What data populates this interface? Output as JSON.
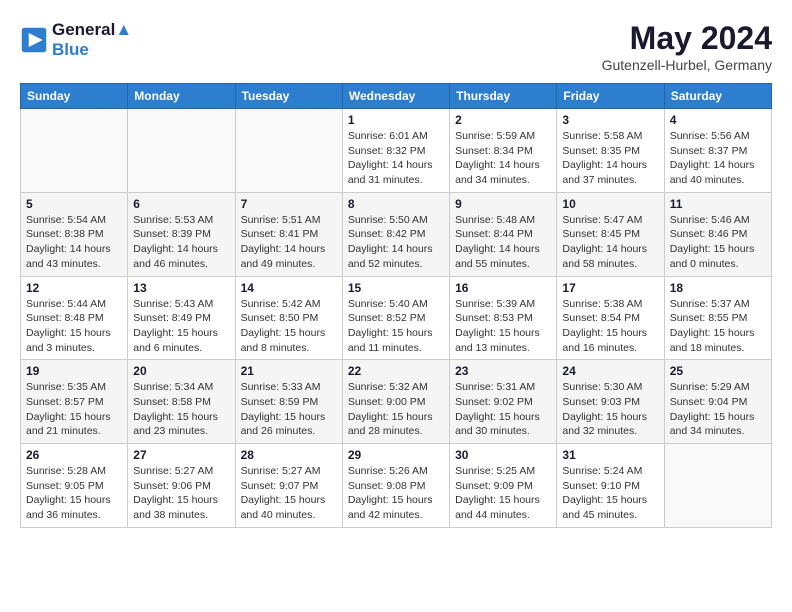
{
  "logo": {
    "line1": "General",
    "line2": "Blue",
    "icon": "▶"
  },
  "title": {
    "month_year": "May 2024",
    "location": "Gutenzell-Hurbel, Germany"
  },
  "weekdays": [
    "Sunday",
    "Monday",
    "Tuesday",
    "Wednesday",
    "Thursday",
    "Friday",
    "Saturday"
  ],
  "weeks": [
    [
      {
        "day": "",
        "info": ""
      },
      {
        "day": "",
        "info": ""
      },
      {
        "day": "",
        "info": ""
      },
      {
        "day": "1",
        "info": "Sunrise: 6:01 AM\nSunset: 8:32 PM\nDaylight: 14 hours\nand 31 minutes."
      },
      {
        "day": "2",
        "info": "Sunrise: 5:59 AM\nSunset: 8:34 PM\nDaylight: 14 hours\nand 34 minutes."
      },
      {
        "day": "3",
        "info": "Sunrise: 5:58 AM\nSunset: 8:35 PM\nDaylight: 14 hours\nand 37 minutes."
      },
      {
        "day": "4",
        "info": "Sunrise: 5:56 AM\nSunset: 8:37 PM\nDaylight: 14 hours\nand 40 minutes."
      }
    ],
    [
      {
        "day": "5",
        "info": "Sunrise: 5:54 AM\nSunset: 8:38 PM\nDaylight: 14 hours\nand 43 minutes."
      },
      {
        "day": "6",
        "info": "Sunrise: 5:53 AM\nSunset: 8:39 PM\nDaylight: 14 hours\nand 46 minutes."
      },
      {
        "day": "7",
        "info": "Sunrise: 5:51 AM\nSunset: 8:41 PM\nDaylight: 14 hours\nand 49 minutes."
      },
      {
        "day": "8",
        "info": "Sunrise: 5:50 AM\nSunset: 8:42 PM\nDaylight: 14 hours\nand 52 minutes."
      },
      {
        "day": "9",
        "info": "Sunrise: 5:48 AM\nSunset: 8:44 PM\nDaylight: 14 hours\nand 55 minutes."
      },
      {
        "day": "10",
        "info": "Sunrise: 5:47 AM\nSunset: 8:45 PM\nDaylight: 14 hours\nand 58 minutes."
      },
      {
        "day": "11",
        "info": "Sunrise: 5:46 AM\nSunset: 8:46 PM\nDaylight: 15 hours\nand 0 minutes."
      }
    ],
    [
      {
        "day": "12",
        "info": "Sunrise: 5:44 AM\nSunset: 8:48 PM\nDaylight: 15 hours\nand 3 minutes."
      },
      {
        "day": "13",
        "info": "Sunrise: 5:43 AM\nSunset: 8:49 PM\nDaylight: 15 hours\nand 6 minutes."
      },
      {
        "day": "14",
        "info": "Sunrise: 5:42 AM\nSunset: 8:50 PM\nDaylight: 15 hours\nand 8 minutes."
      },
      {
        "day": "15",
        "info": "Sunrise: 5:40 AM\nSunset: 8:52 PM\nDaylight: 15 hours\nand 11 minutes."
      },
      {
        "day": "16",
        "info": "Sunrise: 5:39 AM\nSunset: 8:53 PM\nDaylight: 15 hours\nand 13 minutes."
      },
      {
        "day": "17",
        "info": "Sunrise: 5:38 AM\nSunset: 8:54 PM\nDaylight: 15 hours\nand 16 minutes."
      },
      {
        "day": "18",
        "info": "Sunrise: 5:37 AM\nSunset: 8:55 PM\nDaylight: 15 hours\nand 18 minutes."
      }
    ],
    [
      {
        "day": "19",
        "info": "Sunrise: 5:35 AM\nSunset: 8:57 PM\nDaylight: 15 hours\nand 21 minutes."
      },
      {
        "day": "20",
        "info": "Sunrise: 5:34 AM\nSunset: 8:58 PM\nDaylight: 15 hours\nand 23 minutes."
      },
      {
        "day": "21",
        "info": "Sunrise: 5:33 AM\nSunset: 8:59 PM\nDaylight: 15 hours\nand 26 minutes."
      },
      {
        "day": "22",
        "info": "Sunrise: 5:32 AM\nSunset: 9:00 PM\nDaylight: 15 hours\nand 28 minutes."
      },
      {
        "day": "23",
        "info": "Sunrise: 5:31 AM\nSunset: 9:02 PM\nDaylight: 15 hours\nand 30 minutes."
      },
      {
        "day": "24",
        "info": "Sunrise: 5:30 AM\nSunset: 9:03 PM\nDaylight: 15 hours\nand 32 minutes."
      },
      {
        "day": "25",
        "info": "Sunrise: 5:29 AM\nSunset: 9:04 PM\nDaylight: 15 hours\nand 34 minutes."
      }
    ],
    [
      {
        "day": "26",
        "info": "Sunrise: 5:28 AM\nSunset: 9:05 PM\nDaylight: 15 hours\nand 36 minutes."
      },
      {
        "day": "27",
        "info": "Sunrise: 5:27 AM\nSunset: 9:06 PM\nDaylight: 15 hours\nand 38 minutes."
      },
      {
        "day": "28",
        "info": "Sunrise: 5:27 AM\nSunset: 9:07 PM\nDaylight: 15 hours\nand 40 minutes."
      },
      {
        "day": "29",
        "info": "Sunrise: 5:26 AM\nSunset: 9:08 PM\nDaylight: 15 hours\nand 42 minutes."
      },
      {
        "day": "30",
        "info": "Sunrise: 5:25 AM\nSunset: 9:09 PM\nDaylight: 15 hours\nand 44 minutes."
      },
      {
        "day": "31",
        "info": "Sunrise: 5:24 AM\nSunset: 9:10 PM\nDaylight: 15 hours\nand 45 minutes."
      },
      {
        "day": "",
        "info": ""
      }
    ]
  ]
}
